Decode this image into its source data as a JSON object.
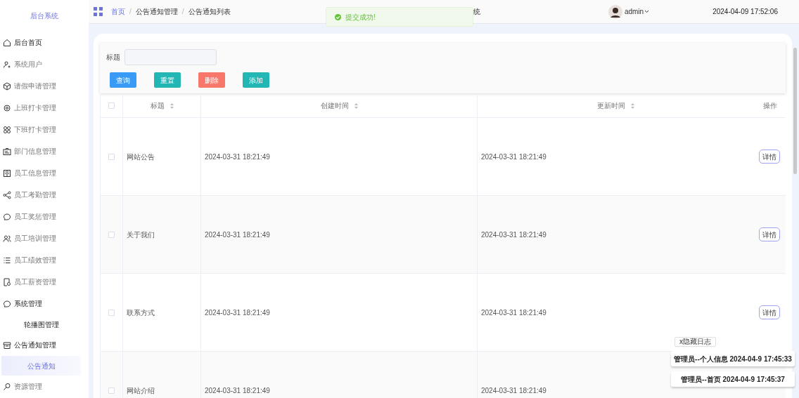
{
  "sidebar": {
    "title": "后台系统",
    "items": [
      {
        "label": "后台首页",
        "kind": "group",
        "selected": false
      },
      {
        "label": "系统用户",
        "kind": "item",
        "selected": false
      },
      {
        "label": "请假申请管理",
        "kind": "item",
        "selected": false
      },
      {
        "label": "上班打卡管理",
        "kind": "item",
        "selected": false
      },
      {
        "label": "下班打卡管理",
        "kind": "item",
        "selected": false
      },
      {
        "label": "部门信息管理",
        "kind": "item",
        "selected": false
      },
      {
        "label": "员工信息管理",
        "kind": "item",
        "selected": false
      },
      {
        "label": "员工考勤管理",
        "kind": "item",
        "selected": false
      },
      {
        "label": "员工奖惩管理",
        "kind": "item",
        "selected": false
      },
      {
        "label": "员工培训管理",
        "kind": "item",
        "selected": false
      },
      {
        "label": "员工绩效管理",
        "kind": "item",
        "selected": false
      },
      {
        "label": "员工薪资管理",
        "kind": "item",
        "selected": false
      },
      {
        "label": "系统管理",
        "kind": "group",
        "selected": false
      },
      {
        "label": "轮播图管理",
        "kind": "sub",
        "selected": false
      },
      {
        "label": "公告通知管理",
        "kind": "group",
        "selected": false
      },
      {
        "label": "公告通知",
        "kind": "sub",
        "selected": true
      },
      {
        "label": "资源管理",
        "kind": "item",
        "selected": false
      }
    ]
  },
  "breadcrumb": [
    {
      "label": "首页",
      "kind": "link"
    },
    {
      "label": "/",
      "kind": "separator"
    },
    {
      "label": "公告通知管理",
      "kind": "text"
    },
    {
      "label": "/",
      "kind": "separator"
    },
    {
      "label": "公告通知列表",
      "kind": "text"
    }
  ],
  "header_title": "统",
  "toast": {
    "text": "提交成功!"
  },
  "user": {
    "name": "admin"
  },
  "datetime": "2024-04-09 17:52:06",
  "search": {
    "label": "标题"
  },
  "buttons": [
    {
      "label": "查询",
      "kind": "primary"
    },
    {
      "label": "重置",
      "kind": "teal"
    },
    {
      "label": "删除",
      "kind": "danger"
    },
    {
      "label": "添加",
      "kind": "teal"
    }
  ],
  "table": {
    "select_all_checked": false,
    "columns": [
      "标题",
      "创建时间",
      "更新时间",
      "操作"
    ],
    "rows": [
      {
        "checked": false,
        "title": "网站公告",
        "created": "2024-03-31 18:21:49",
        "updated": "2024-03-31 18:21:49",
        "action": "详情"
      },
      {
        "checked": false,
        "title": "关于我们",
        "created": "2024-03-31 18:21:49",
        "updated": "2024-03-31 18:21:49",
        "action": "详情"
      },
      {
        "checked": false,
        "title": "联系方式",
        "created": "2024-03-31 18:21:49",
        "updated": "2024-03-31 18:21:49",
        "action": "详情"
      },
      {
        "checked": false,
        "title": "网站介绍",
        "created": "2024-03-31 18:21:49",
        "updated": "2024-03-31 18:21:49"
      }
    ]
  },
  "log": {
    "toggle": "x隐藏日志",
    "entries": [
      "管理员--个人信息 2024-04-9 17:45:33",
      "管理员--首页 2024-04-9 17:45:37"
    ]
  }
}
